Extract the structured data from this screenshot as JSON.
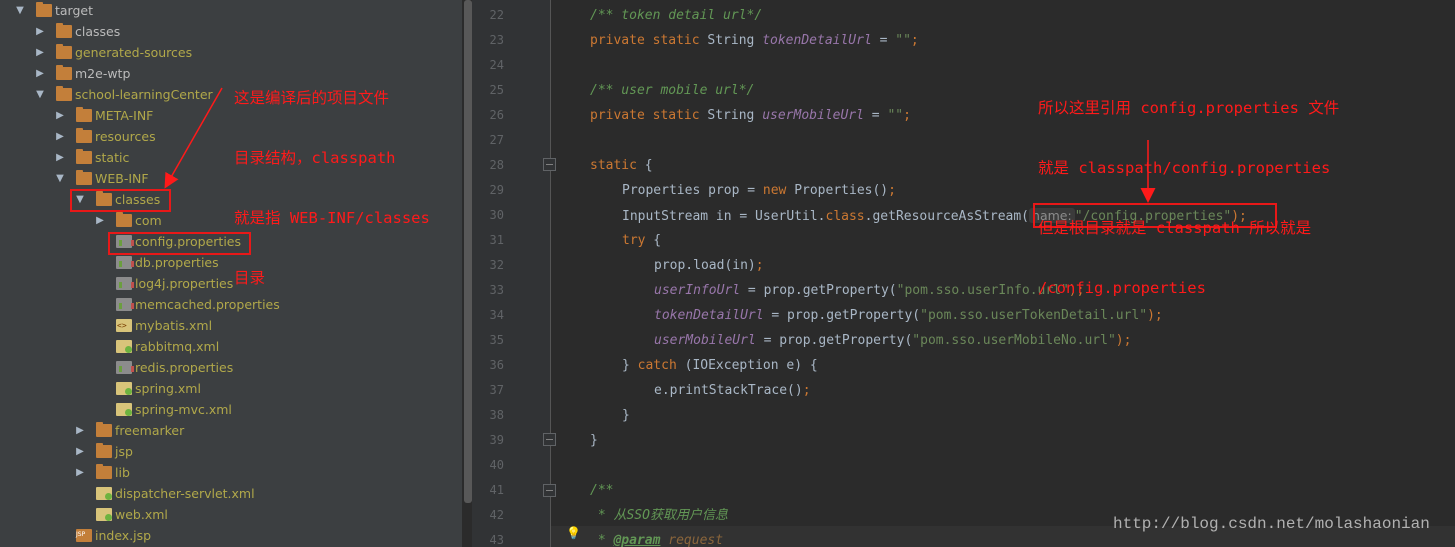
{
  "tree": {
    "items": [
      {
        "label": "target",
        "depth": 0,
        "expanded": true,
        "icon": "folder-icon",
        "out": false
      },
      {
        "label": "classes",
        "depth": 1,
        "expanded": false,
        "icon": "folder-icon",
        "out": false
      },
      {
        "label": "generated-sources",
        "depth": 1,
        "expanded": false,
        "icon": "folder-icon",
        "out": true
      },
      {
        "label": "m2e-wtp",
        "depth": 1,
        "expanded": false,
        "icon": "folder-icon",
        "out": false
      },
      {
        "label": "school-learningCenter",
        "depth": 1,
        "expanded": true,
        "icon": "folder-icon",
        "out": true
      },
      {
        "label": "META-INF",
        "depth": 2,
        "expanded": false,
        "icon": "folder-icon",
        "out": true
      },
      {
        "label": "resources",
        "depth": 2,
        "expanded": false,
        "icon": "folder-icon",
        "out": true
      },
      {
        "label": "static",
        "depth": 2,
        "expanded": false,
        "icon": "folder-icon",
        "out": true
      },
      {
        "label": "WEB-INF",
        "depth": 2,
        "expanded": true,
        "icon": "folder-icon",
        "out": true
      },
      {
        "label": "classes",
        "depth": 3,
        "expanded": true,
        "icon": "folder-icon",
        "out": true
      },
      {
        "label": "com",
        "depth": 4,
        "expanded": false,
        "icon": "folder-icon",
        "out": true
      },
      {
        "label": "config.properties",
        "depth": 4,
        "expanded": null,
        "icon": "properties-file-icon",
        "out": true
      },
      {
        "label": "db.properties",
        "depth": 4,
        "expanded": null,
        "icon": "properties-file-icon",
        "out": true
      },
      {
        "label": "log4j.properties",
        "depth": 4,
        "expanded": null,
        "icon": "properties-file-icon",
        "out": true
      },
      {
        "label": "memcached.properties",
        "depth": 4,
        "expanded": null,
        "icon": "properties-file-icon",
        "out": true
      },
      {
        "label": "mybatis.xml",
        "depth": 4,
        "expanded": null,
        "icon": "xml-file-icon",
        "out": true
      },
      {
        "label": "rabbitmq.xml",
        "depth": 4,
        "expanded": null,
        "icon": "spring-xml-file-icon",
        "out": true
      },
      {
        "label": "redis.properties",
        "depth": 4,
        "expanded": null,
        "icon": "properties-file-icon",
        "out": true
      },
      {
        "label": "spring.xml",
        "depth": 4,
        "expanded": null,
        "icon": "spring-xml-file-icon",
        "out": true
      },
      {
        "label": "spring-mvc.xml",
        "depth": 4,
        "expanded": null,
        "icon": "spring-xml-file-icon",
        "out": true
      },
      {
        "label": "freemarker",
        "depth": 3,
        "expanded": false,
        "icon": "folder-icon",
        "out": true
      },
      {
        "label": "jsp",
        "depth": 3,
        "expanded": false,
        "icon": "folder-icon",
        "out": true
      },
      {
        "label": "lib",
        "depth": 3,
        "expanded": false,
        "icon": "folder-icon",
        "out": true
      },
      {
        "label": "dispatcher-servlet.xml",
        "depth": 3,
        "expanded": null,
        "icon": "spring-xml-file-icon",
        "out": true
      },
      {
        "label": "web.xml",
        "depth": 3,
        "expanded": null,
        "icon": "web-xml-file-icon",
        "out": true
      },
      {
        "label": "index.jsp",
        "depth": 2,
        "expanded": null,
        "icon": "jsp-file-icon",
        "out": true
      }
    ]
  },
  "editor": {
    "line_numbers": [
      "22",
      "23",
      "24",
      "25",
      "26",
      "27",
      "28",
      "29",
      "30",
      "31",
      "32",
      "33",
      "34",
      "35",
      "36",
      "37",
      "38",
      "39",
      "40",
      "41",
      "42",
      "43"
    ],
    "lines": {
      "l22": {
        "comment": "/** token detail url*/"
      },
      "l23": {
        "kw": "private static ",
        "type": "String ",
        "field": "tokenDetailUrl",
        "rest": " = ",
        "str": "\"\"",
        "end": ";"
      },
      "l25": {
        "comment": "/** user mobile url*/"
      },
      "l26": {
        "kw": "private static ",
        "type": "String ",
        "field": "userMobileUrl",
        "rest": " = ",
        "str": "\"\"",
        "end": ";"
      },
      "l28": {
        "kw": "static",
        "rest": " {"
      },
      "l29": {
        "a": "Properties prop = ",
        "kw": "new ",
        "b": "Properties()",
        "end": ";"
      },
      "l30": {
        "a": "InputStream in = UserUtil.",
        "kw": "class",
        "b": ".getResourceAsStream(",
        "hint": "name:",
        "str": "\"/config.properties\"",
        "end": ");"
      },
      "l31": {
        "kw": "try",
        "rest": " {"
      },
      "l32": {
        "a": "prop.load(in)",
        "end": ";"
      },
      "l33": {
        "field": "userInfoUrl",
        "a": " = prop.getProperty(",
        "str": "\"pom.sso.userInfo.url\"",
        "end": ");"
      },
      "l34": {
        "field": "tokenDetailUrl",
        "a": " = prop.getProperty(",
        "str": "\"pom.sso.userTokenDetail.url\"",
        "end": ");"
      },
      "l35": {
        "field": "userMobileUrl",
        "a": " = prop.getProperty(",
        "str": "\"pom.sso.userMobileNo.url\"",
        "end": ");"
      },
      "l36": {
        "a": "} ",
        "kw": "catch",
        "b": " (IOException e) {"
      },
      "l37": {
        "a": "e.printStackTrace()",
        "end": ";"
      },
      "l38": {
        "a": "}"
      },
      "l39": {
        "a": "}"
      },
      "l41": {
        "comment": "/**"
      },
      "l42": {
        "comment": " * 从SSO获取用户信息"
      },
      "l43": {
        "comment": " * ",
        "tag": "@param",
        "param": " request"
      }
    }
  },
  "annotations": {
    "left_note": [
      "这是编译后的项目文件",
      "目录结构，classpath",
      "就是指 WEB-INF/classes",
      "目录"
    ],
    "right_note": [
      "所以这里引用 config.properties 文件",
      "就是 classpath/config.properties",
      "但是根目录就是 classpath 所以就是",
      "/config.properties"
    ],
    "color": "#ff1a1a"
  },
  "watermark": "http://blog.csdn.net/molashaonian",
  "colors": {
    "tree_bg": "#3c3f41",
    "editor_bg": "#2b2b2b",
    "keyword": "#cc7832",
    "string": "#6a8759",
    "comment": "#629755",
    "field": "#9876aa",
    "output_text": "#b1a84a"
  }
}
